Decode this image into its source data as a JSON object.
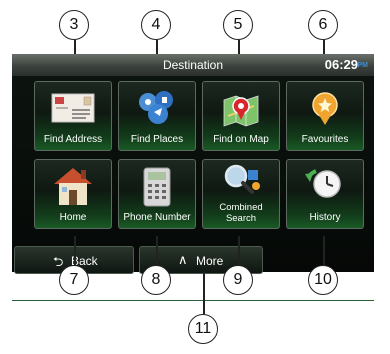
{
  "screen": {
    "title": "Destination",
    "clock": "06:29",
    "ampm": "PM"
  },
  "tiles": [
    {
      "label": "Find Address",
      "icon": "envelope-icon"
    },
    {
      "label": "Find Places",
      "icon": "places-icon"
    },
    {
      "label": "Find on Map",
      "icon": "map-pin-icon"
    },
    {
      "label": "Favourites",
      "icon": "favourite-star-icon"
    },
    {
      "label": "Home",
      "icon": "house-icon"
    },
    {
      "label": "Phone Number",
      "icon": "phone-icon"
    },
    {
      "label_line1": "Combined",
      "label_line2": "Search",
      "icon": "magnifier-icon"
    },
    {
      "label": "History",
      "icon": "clock-arrow-icon"
    }
  ],
  "buttons": {
    "back": {
      "label": "Back",
      "icon": "back-arrow-icon"
    },
    "more": {
      "label": "More",
      "icon": "chevron-up-icon"
    }
  },
  "callouts": [
    "3",
    "4",
    "5",
    "6",
    "7",
    "8",
    "9",
    "10",
    "11"
  ]
}
